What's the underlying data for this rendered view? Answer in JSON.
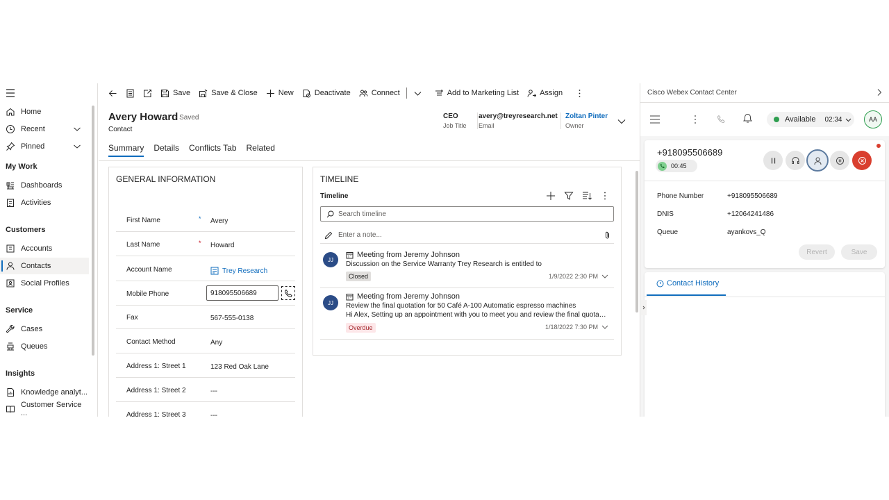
{
  "sitemap": {
    "home": "Home",
    "recent": "Recent",
    "pinned": "Pinned",
    "my_work": "My Work",
    "dashboards": "Dashboards",
    "activities": "Activities",
    "customers": "Customers",
    "accounts": "Accounts",
    "contacts": "Contacts",
    "social_profiles": "Social Profiles",
    "service": "Service",
    "cases": "Cases",
    "queues": "Queues",
    "insights": "Insights",
    "knowledge": "Knowledge analyt...",
    "customer_service": "Customer Service ..."
  },
  "commands": {
    "save": "Save",
    "save_close": "Save & Close",
    "new": "New",
    "deactivate": "Deactivate",
    "connect": "Connect",
    "add_marketing": "Add to Marketing List",
    "assign": "Assign"
  },
  "record": {
    "name": "Avery Howard",
    "saved": "- Saved",
    "entity": "Contact",
    "job_title_value": "CEO",
    "job_title_label": "Job Title",
    "email_value": "avery@treyresearch.net",
    "email_label": "Email",
    "owner_value": "Zoltan Pinter",
    "owner_label": "Owner"
  },
  "tabs": [
    "Summary",
    "Details",
    "Conflicts Tab",
    "Related"
  ],
  "general": {
    "title": "GENERAL INFORMATION",
    "first_name_label": "First Name",
    "first_name_req": "*",
    "first_name": "Avery",
    "last_name_label": "Last Name",
    "last_name_req": "*",
    "last_name": "Howard",
    "account_label": "Account Name",
    "account": "Trey Research",
    "mobile_label": "Mobile Phone",
    "mobile": "918095506689",
    "fax_label": "Fax",
    "fax": "567-555-0138",
    "method_label": "Contact Method",
    "method": "Any",
    "street1_label": "Address 1: Street 1",
    "street1": "123 Red Oak Lane",
    "street2_label": "Address 1: Street 2",
    "street2": "---",
    "street3_label": "Address 1: Street 3",
    "street3": "---"
  },
  "timeline": {
    "title": "TIMELINE",
    "subtitle": "Timeline",
    "search_placeholder": "Search timeline",
    "note_placeholder": "Enter a note...",
    "items": [
      {
        "initials": "JJ",
        "title": "Meeting from Jeremy Johnson",
        "desc": "Discussion on the Service Warranty Trey Research is entitled to",
        "desc2": "",
        "badge": "Closed",
        "date": "1/9/2022 2:30 PM"
      },
      {
        "initials": "JJ",
        "title": "Meeting from Jeremy Johnson",
        "desc": "Review the final quotation for 50 Café A-100 Automatic espresso machines",
        "desc2": "Hi Alex, Setting up an appointment with you to meet you and review the final quotation",
        "badge": "Overdue",
        "date": "1/18/2022 7:30 PM"
      }
    ]
  },
  "webex": {
    "panel_title": "Cisco Webex Contact Center",
    "status": "Available",
    "status_timer": "02:34",
    "avatar": "AA",
    "caller": "+918095506689",
    "call_timer": "00:45",
    "phone_label": "Phone Number",
    "phone_value": "+918095506689",
    "dnis_label": "DNIS",
    "dnis_value": "+12064241486",
    "queue_label": "Queue",
    "queue_value": "ayankovs_Q",
    "revert": "Revert",
    "save": "Save",
    "history_tab": "Contact History"
  },
  "colors": {
    "accent": "#0f6cbd",
    "available": "#2e9e4f",
    "end_call": "#d93f2f"
  }
}
